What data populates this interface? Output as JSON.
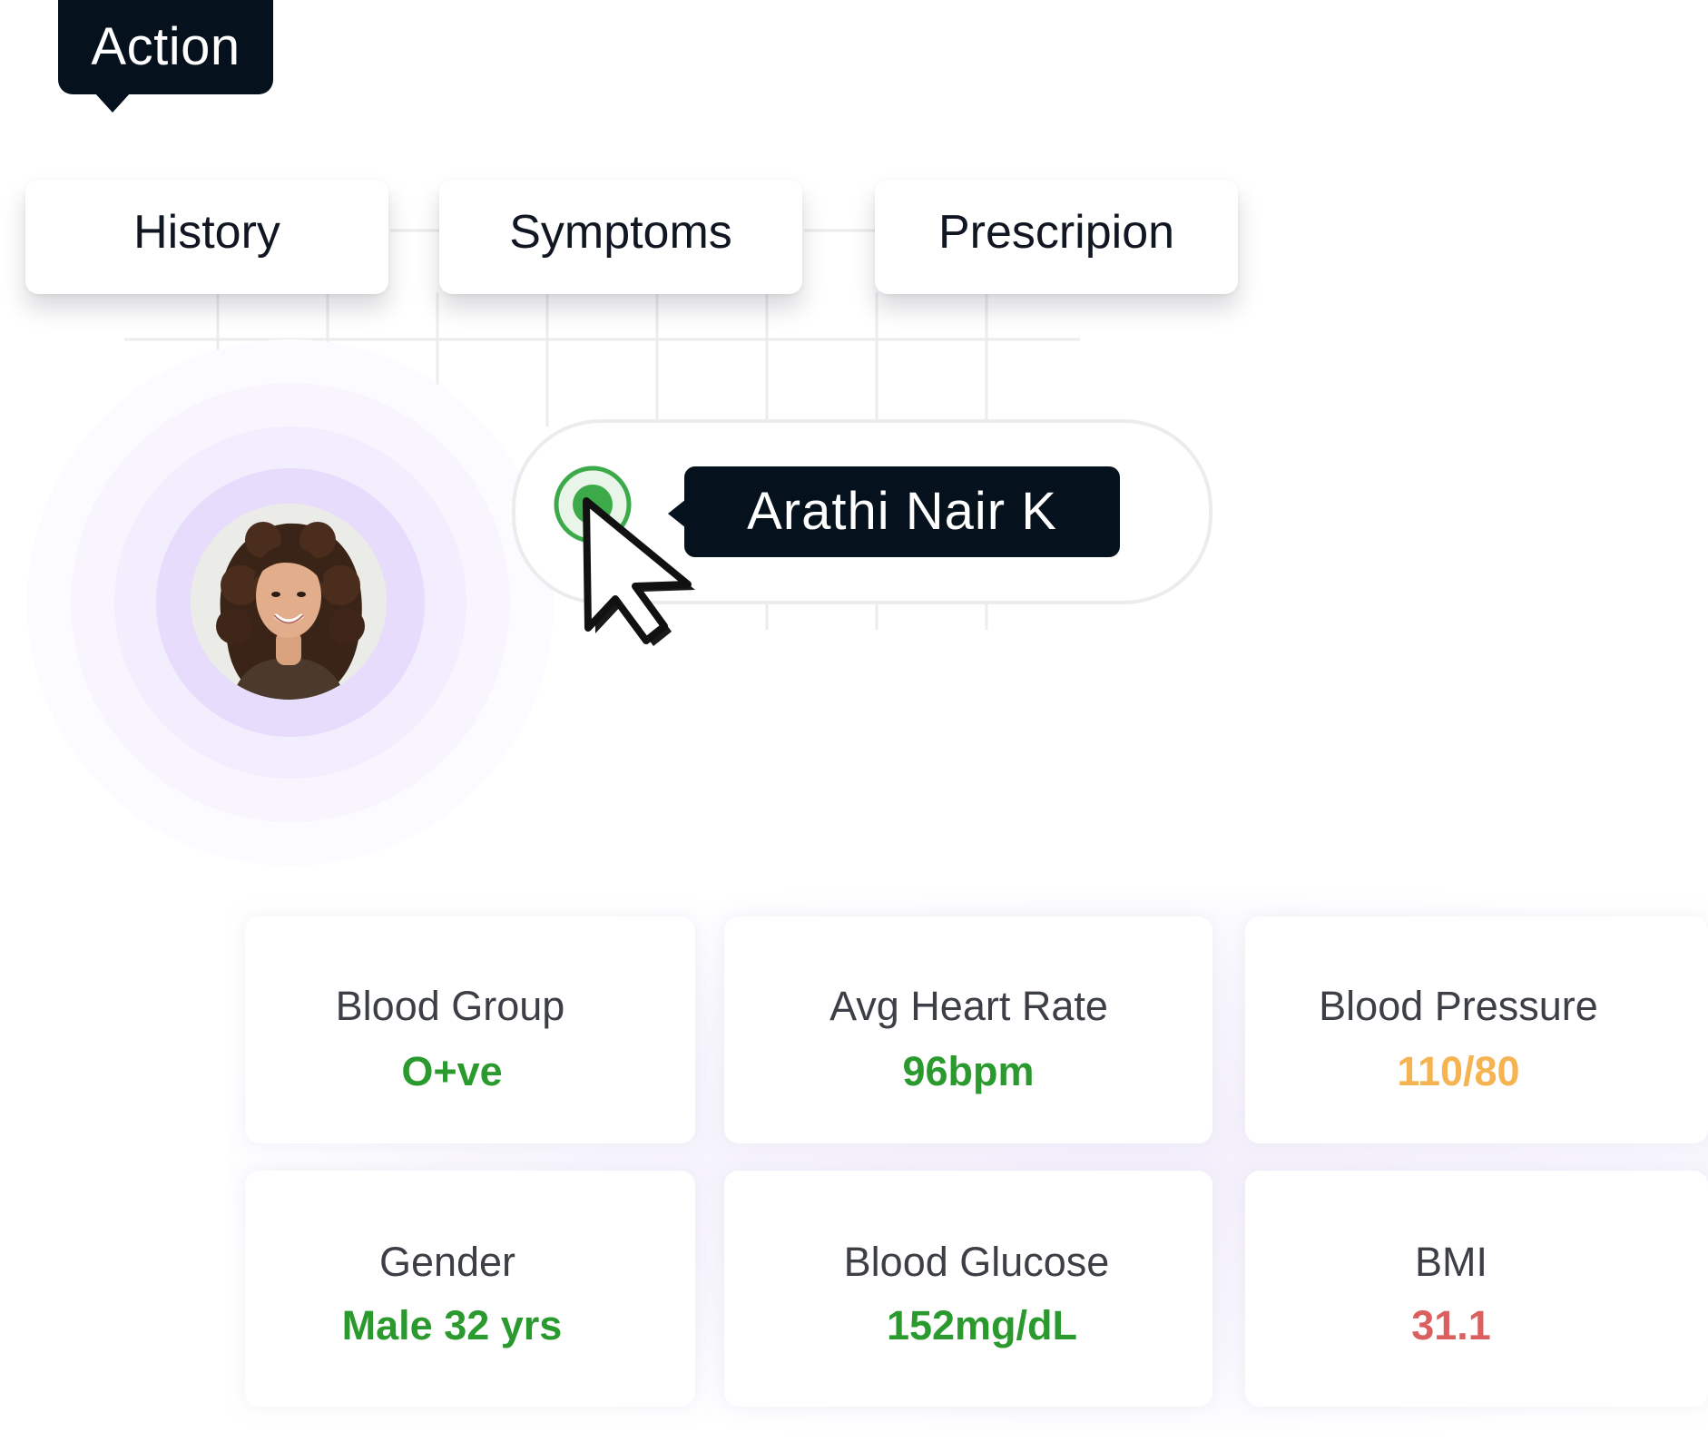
{
  "action_tooltip": {
    "label": "Action"
  },
  "tabs": [
    {
      "label": "History"
    },
    {
      "label": "Symptoms"
    },
    {
      "label": "Prescripion"
    }
  ],
  "patient": {
    "name": "Arathi Nair K",
    "status_color": "#3daa4a"
  },
  "vitals": {
    "blood_group": {
      "label": "Blood Group",
      "value": "O+ve",
      "color": "#2b9a2e"
    },
    "heart_rate": {
      "label": "Avg Heart Rate",
      "value": "96bpm",
      "color": "#2b9a2e"
    },
    "blood_pressure": {
      "label": "Blood Pressure",
      "value": "110/80",
      "color": "#f5b351"
    },
    "gender": {
      "label": "Gender",
      "value": "Male 32 yrs",
      "color": "#2b9a2e"
    },
    "blood_glucose": {
      "label": "Blood Glucose",
      "value": "152mg/dL",
      "color": "#2b9a2e"
    },
    "bmi": {
      "label": "BMI",
      "value": "31.1",
      "color": "#dc5f5f"
    }
  }
}
